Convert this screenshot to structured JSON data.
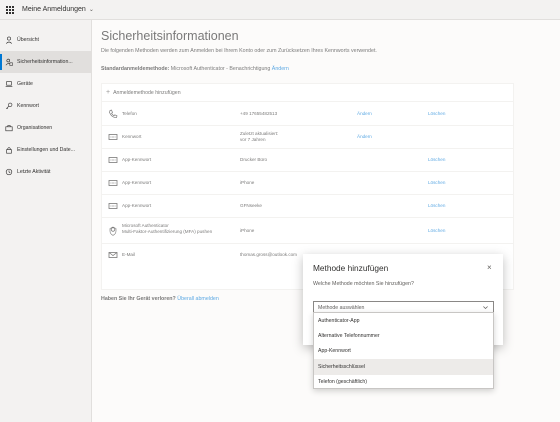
{
  "topbar": {
    "app_title": "Meine Anmeldungen",
    "chevron": "⌄"
  },
  "sidebar": {
    "items": [
      {
        "label": "Übersicht",
        "icon": "person-icon",
        "active": false
      },
      {
        "label": "Sicherheitsinformation...",
        "icon": "security-info-icon",
        "active": true
      },
      {
        "label": "Geräte",
        "icon": "laptop-icon",
        "active": false
      },
      {
        "label": "Kennwort",
        "icon": "key-icon",
        "active": false
      },
      {
        "label": "Organisationen",
        "icon": "briefcase-icon",
        "active": false
      },
      {
        "label": "Einstellungen und Date...",
        "icon": "settings-lock-icon",
        "active": false
      },
      {
        "label": "Letzte Aktivität",
        "icon": "history-icon",
        "active": false
      }
    ]
  },
  "main": {
    "title": "Sicherheitsinformationen",
    "subtitle": "Die folgenden Methoden werden zum Anmelden bei Ihrem Konto oder zum Zurücksetzen Ihres Kennworts verwendet.",
    "default_method_label": "Standardanmeldemethode:",
    "default_method_value": "Microsoft Authenticator - Benachrichtigung",
    "default_method_change": "Ändern",
    "add_method": "Anmeldemethode hinzufügen",
    "methods": [
      {
        "icon": "phone-icon",
        "name": "Telefon",
        "detail": "+49 17655482513",
        "change": "Ändern",
        "delete": "Löschen"
      },
      {
        "icon": "password-icon",
        "name": "Kennwort",
        "detail_line1": "Zuletzt aktualisiert:",
        "detail_line2": "vor 7 Jahren",
        "change": "Ändern",
        "delete": ""
      },
      {
        "icon": "app-password-icon",
        "name": "App-Kennwort",
        "detail": "Drucker Büro",
        "change": "",
        "delete": "Löschen"
      },
      {
        "icon": "app-password-icon",
        "name": "App-Kennwort",
        "detail": "iPhone",
        "change": "",
        "delete": "Löschen"
      },
      {
        "icon": "app-password-icon",
        "name": "App-Kennwort",
        "detail": "GFNseeke",
        "change": "",
        "delete": "Löschen"
      },
      {
        "icon": "authenticator-icon",
        "name_line1": "Microsoft Authenticator",
        "name_line2": "Multi-Faktor-Authentifizierung (MFA) pushen",
        "detail": "iPhone",
        "change": "",
        "delete": "Löschen"
      },
      {
        "icon": "email-icon",
        "name": "E-Mail",
        "detail": "thomas.gross@outlook.com",
        "change": "",
        "delete": ""
      }
    ],
    "lost_device_label": "Haben Sie Ihr Gerät verloren?",
    "lost_device_link": "Überall abmelden"
  },
  "dialog": {
    "title": "Methode hinzufügen",
    "close": "×",
    "question": "Welche Methode möchten Sie hinzufügen?",
    "select_placeholder": "Methode auswählen",
    "options": [
      "Authenticator-App",
      "Alternative Telefonnummer",
      "App-Kennwort",
      "Sicherheitsschlüssel",
      "Telefon (geschäftlich)"
    ],
    "hovered_option": "Sicherheitsschlüssel"
  },
  "colors": {
    "accent": "#0078d4",
    "background": "#f3f2f1",
    "text": "#323130"
  }
}
